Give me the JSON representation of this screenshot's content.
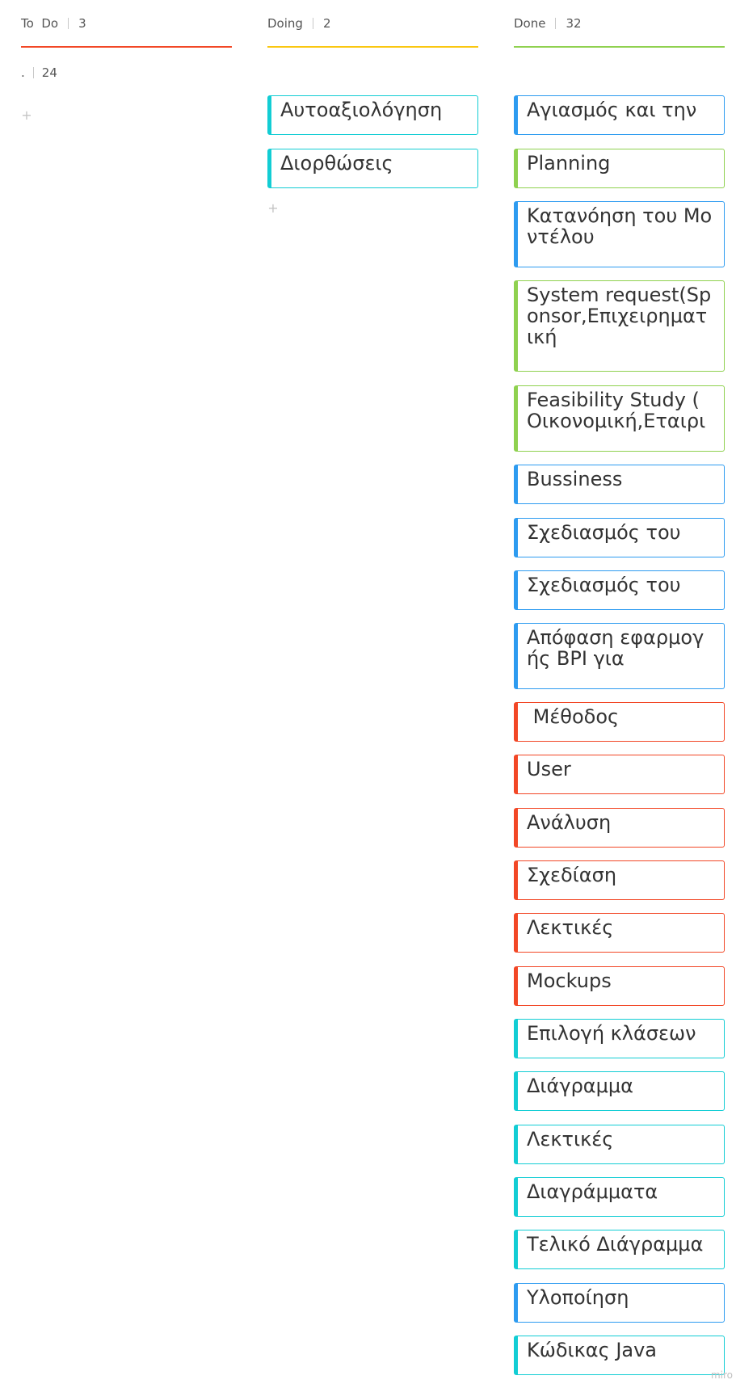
{
  "colors": {
    "todo": "#f24726",
    "doing": "#fac710",
    "done": "#8fd14f",
    "blue": "#2d9bf0",
    "green": "#8fd14f",
    "red": "#f24726",
    "teal": "#12cdd4"
  },
  "columns": {
    "todo": {
      "title": "To  Do",
      "count": "3",
      "subgroup": {
        "title": ".",
        "count": "24"
      },
      "add_icon": "+"
    },
    "doing": {
      "title": "Doing",
      "count": "2",
      "add_icon": "+",
      "cards": [
        {
          "text": "Αυτοαξιολόγηση",
          "color": "teal"
        },
        {
          "text": "Διορθώσεις",
          "color": "teal"
        }
      ]
    },
    "done": {
      "title": "Done",
      "count": "32",
      "cards": [
        {
          "text": "Αγιασμός και την",
          "color": "blue"
        },
        {
          "text": "Planning",
          "color": "green"
        },
        {
          "text": "Κατανόηση του Μοντέλου",
          "color": "blue"
        },
        {
          "text": "System request(Sponsor,Επιχειρηματική",
          "color": "green"
        },
        {
          "text": "Feasibility Study ( Οικονομική,Εταιρι",
          "color": "green"
        },
        {
          "text": "Bussiness",
          "color": "blue"
        },
        {
          "text": "Σχεδιασμός του",
          "color": "blue"
        },
        {
          "text": "Σχεδιασμός του",
          "color": "blue"
        },
        {
          "text": "Απόφαση εφαρμογής BPI για",
          "color": "blue"
        },
        {
          "text": " Μέθοδος",
          "color": "red"
        },
        {
          "text": "User",
          "color": "red"
        },
        {
          "text": "Ανάλυση",
          "color": "red"
        },
        {
          "text": "Σχεδίαση",
          "color": "red"
        },
        {
          "text": "Λεκτικές",
          "color": "red"
        },
        {
          "text": "Mockups",
          "color": "red"
        },
        {
          "text": "Επιλογή κλάσεων",
          "color": "teal"
        },
        {
          "text": "Διάγραμμα",
          "color": "teal"
        },
        {
          "text": "Λεκτικές",
          "color": "teal"
        },
        {
          "text": "Διαγράμματα",
          "color": "teal"
        },
        {
          "text": "Τελικό Διάγραμμα",
          "color": "teal"
        },
        {
          "text": "Υλοποίηση",
          "color": "blue"
        },
        {
          "text": "Κώδικας Java",
          "color": "teal"
        }
      ]
    }
  },
  "footer": {
    "logo": "miro"
  }
}
